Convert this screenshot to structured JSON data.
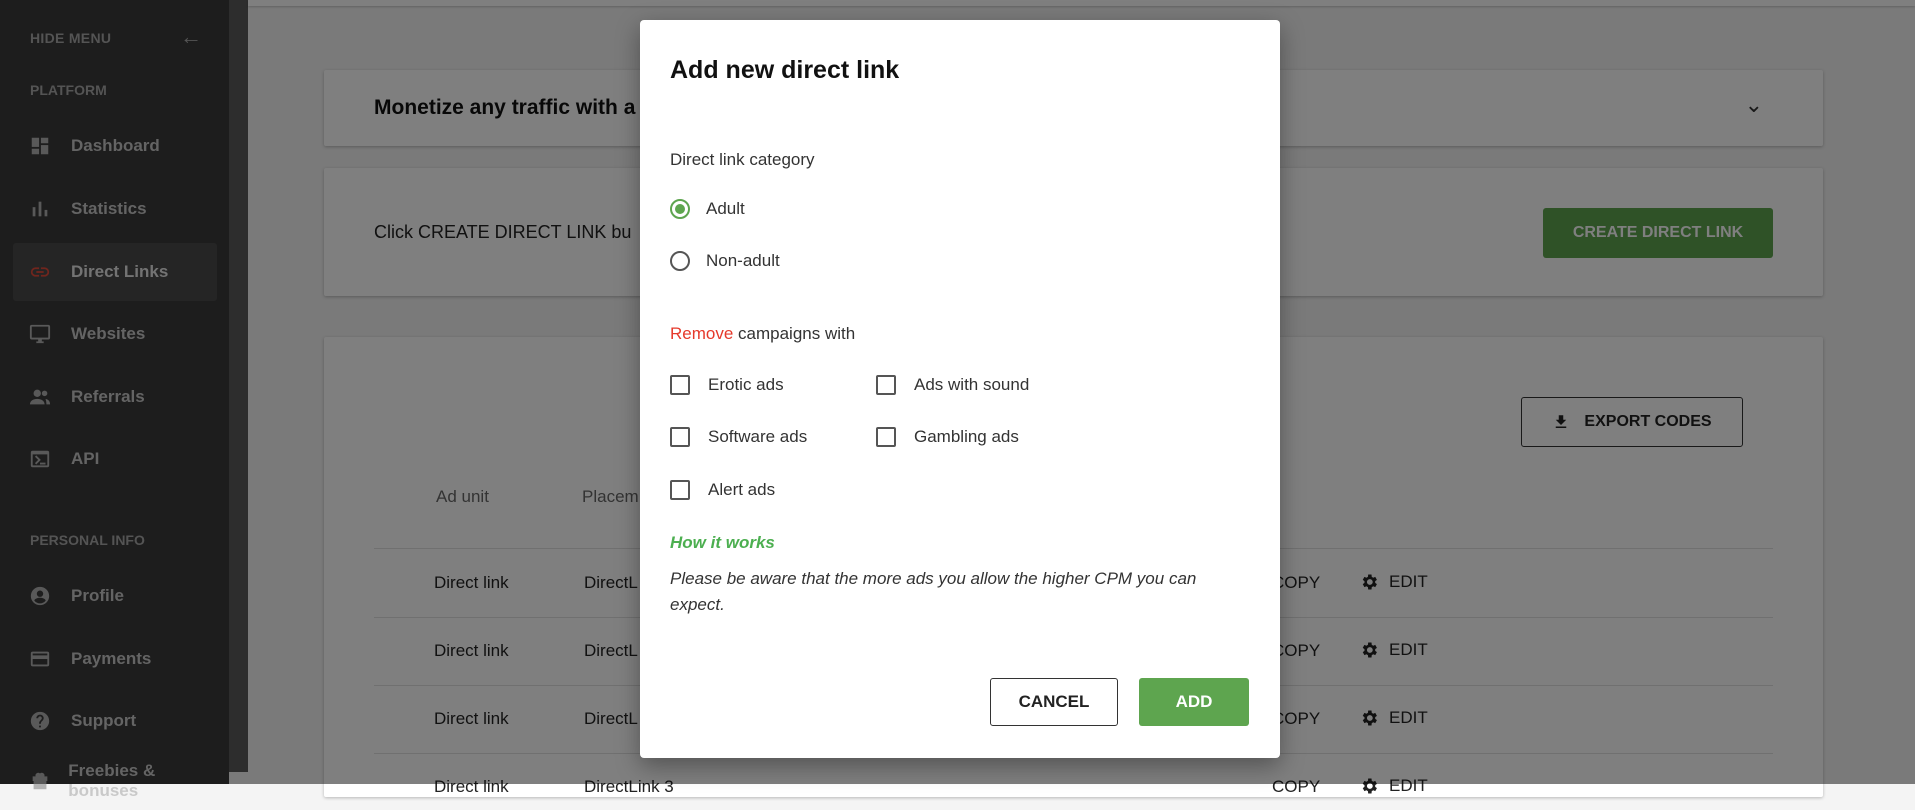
{
  "sidebar": {
    "hide_menu": "HIDE MENU",
    "platform_label": "PLATFORM",
    "personal_label": "PERSONAL INFO",
    "items": [
      {
        "label": "Dashboard"
      },
      {
        "label": "Statistics"
      },
      {
        "label": "Direct Links"
      },
      {
        "label": "Websites"
      },
      {
        "label": "Referrals"
      },
      {
        "label": "API"
      },
      {
        "label": "Profile"
      },
      {
        "label": "Payments"
      },
      {
        "label": "Support"
      },
      {
        "label": "Freebies & bonuses"
      }
    ]
  },
  "main": {
    "card1_title": "Monetize any traffic with a",
    "card2_text": "Click CREATE DIRECT LINK bu",
    "create_button": "CREATE DIRECT LINK",
    "export_button": "EXPORT CODES",
    "columns": [
      "Ad unit",
      "Placem"
    ],
    "rows": [
      {
        "ad_unit": "Direct link",
        "placement": "DirectL",
        "copy": "COPY",
        "edit": "EDIT"
      },
      {
        "ad_unit": "Direct link",
        "placement": "DirectL",
        "copy": "COPY",
        "edit": "EDIT"
      },
      {
        "ad_unit": "Direct link",
        "placement": "DirectL",
        "copy": "COPY",
        "edit": "EDIT"
      },
      {
        "ad_unit": "Direct link",
        "placement": "DirectLink 3",
        "copy": "COPY",
        "edit": "EDIT"
      }
    ]
  },
  "modal": {
    "title": "Add new direct link",
    "category_label": "Direct link category",
    "options": [
      "Adult",
      "Non-adult"
    ],
    "selected_option": "Adult",
    "remove_word": "Remove",
    "remove_rest": " campaigns with",
    "checkboxes": [
      "Erotic ads",
      "Ads with sound",
      "Software ads",
      "Gambling ads",
      "Alert ads"
    ],
    "how_it_works": "How it works",
    "note": "Please be aware that the more ads you allow the higher CPM you can expect.",
    "cancel": "CANCEL",
    "add": "ADD"
  },
  "colors": {
    "accent_green": "#5ea54f",
    "remove_red": "#e5392b",
    "sidebar_bg": "#3a3a3a"
  }
}
